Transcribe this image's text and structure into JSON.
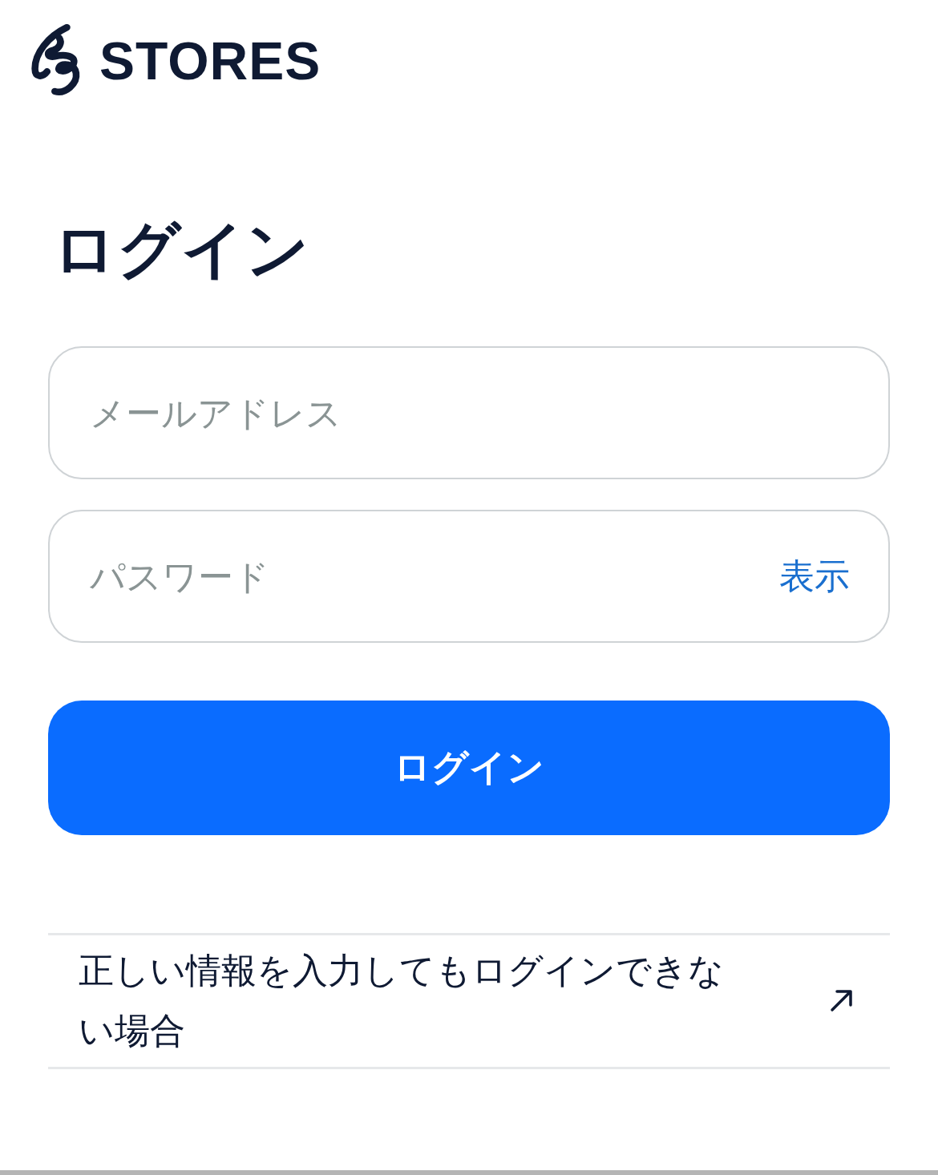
{
  "header": {
    "brand": "STORES"
  },
  "title": "ログイン",
  "fields": [
    {
      "placeholder": "メールアドレス"
    },
    {
      "placeholder": "パスワード",
      "toggle": "表示"
    }
  ],
  "submit": "ログイン",
  "help_link": {
    "label": "正しい情報を入力してもログインできない場合"
  }
}
